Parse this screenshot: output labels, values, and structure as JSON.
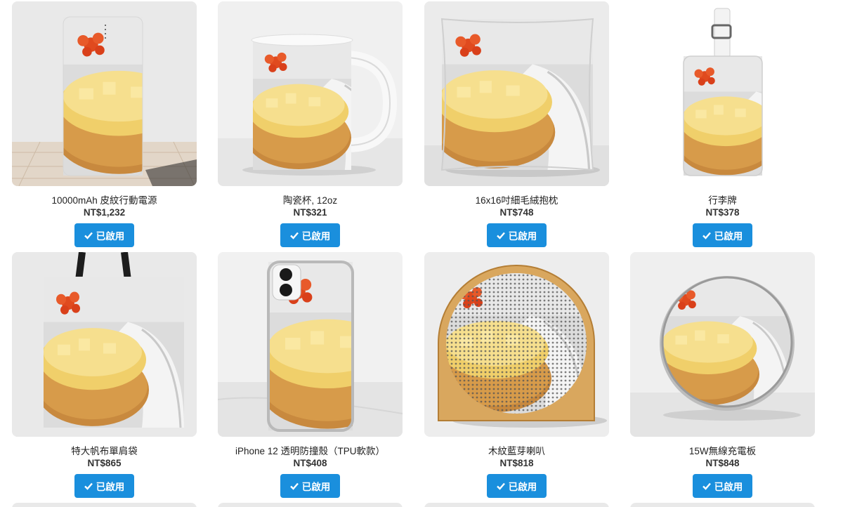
{
  "products": [
    {
      "name": "10000mAh 皮紋行動電源",
      "price": "NT$1,232",
      "button": "已啟用",
      "icon": "power-bank"
    },
    {
      "name": "陶瓷杯, 12oz",
      "price": "NT$321",
      "button": "已啟用",
      "icon": "mug"
    },
    {
      "name": "16x16吋細毛絨抱枕",
      "price": "NT$748",
      "button": "已啟用",
      "icon": "pillow"
    },
    {
      "name": "行李牌",
      "price": "NT$378",
      "button": "已啟用",
      "icon": "luggage-tag"
    },
    {
      "name": "特大帆布單肩袋",
      "price": "NT$865",
      "button": "已啟用",
      "icon": "tote-bag"
    },
    {
      "name": "iPhone 12 透明防撞殼（TPU軟款）",
      "price": "NT$408",
      "button": "已啟用",
      "icon": "phone-case"
    },
    {
      "name": "木紋藍芽喇叭",
      "price": "NT$818",
      "button": "已啟用",
      "icon": "speaker"
    },
    {
      "name": "15W無線充電板",
      "price": "NT$848",
      "button": "已啟用",
      "icon": "wireless-charger"
    }
  ],
  "colors": {
    "button_bg": "#1a8fdd",
    "button_text": "#ffffff",
    "card_bg": "#ececec"
  }
}
